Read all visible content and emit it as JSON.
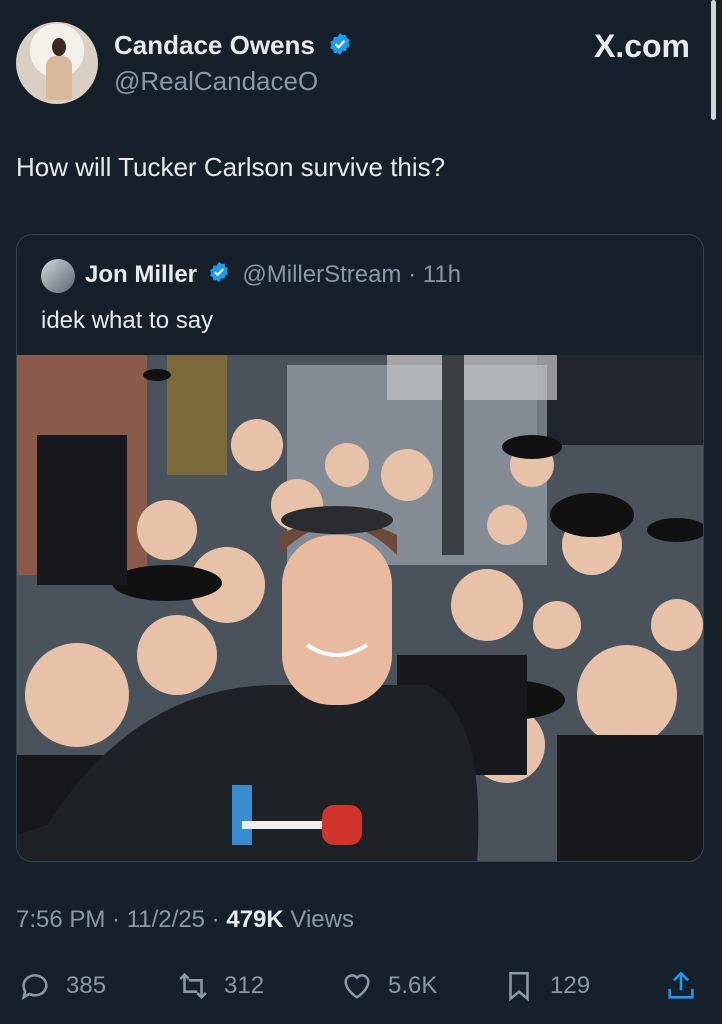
{
  "author": {
    "name": "Candace Owens",
    "handle": "@RealCandaceO"
  },
  "site": "X.com",
  "tweet": {
    "text": "How will Tucker Carlson survive this?"
  },
  "quoted": {
    "name": "Jon Miller",
    "handle": "@MillerStream",
    "age": "11h",
    "text": "idek what to say"
  },
  "meta": {
    "time": "7:56 PM",
    "date": "11/2/25",
    "views_count": "479K",
    "views_label": "Views"
  },
  "actions": {
    "replies": "385",
    "reposts": "312",
    "likes": "5.6K",
    "bookmarks": "129"
  },
  "colors": {
    "background": "#15202b",
    "text": "#e7e9ea",
    "secondary": "#8b98a5",
    "verified": "#1d9bf0"
  }
}
